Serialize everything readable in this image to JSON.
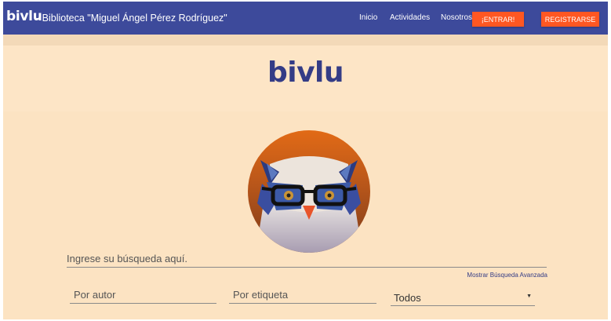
{
  "navbar": {
    "brand": "bivlu",
    "title": " - Biblioteca \"Miguel Ángel Pérez Rodríguez\"",
    "links": [
      "Inicio",
      "Actividades",
      "Nosotros"
    ],
    "login_label": "¡ENTRAR!",
    "register_label": "REGISTRARSE",
    "bg_color": "#3d4a9b",
    "button_color": "#ff5722"
  },
  "hero": {
    "logo_text": "bivlu",
    "mascot_icon": "owl-with-glasses"
  },
  "search": {
    "placeholder": "Ingrese su búsqueda aquí.",
    "advanced_link": "Mostrar Búsqueda Avanzada",
    "author_placeholder": "Por autor",
    "tag_placeholder": "Por etiqueta",
    "type_selected": "Todos"
  }
}
